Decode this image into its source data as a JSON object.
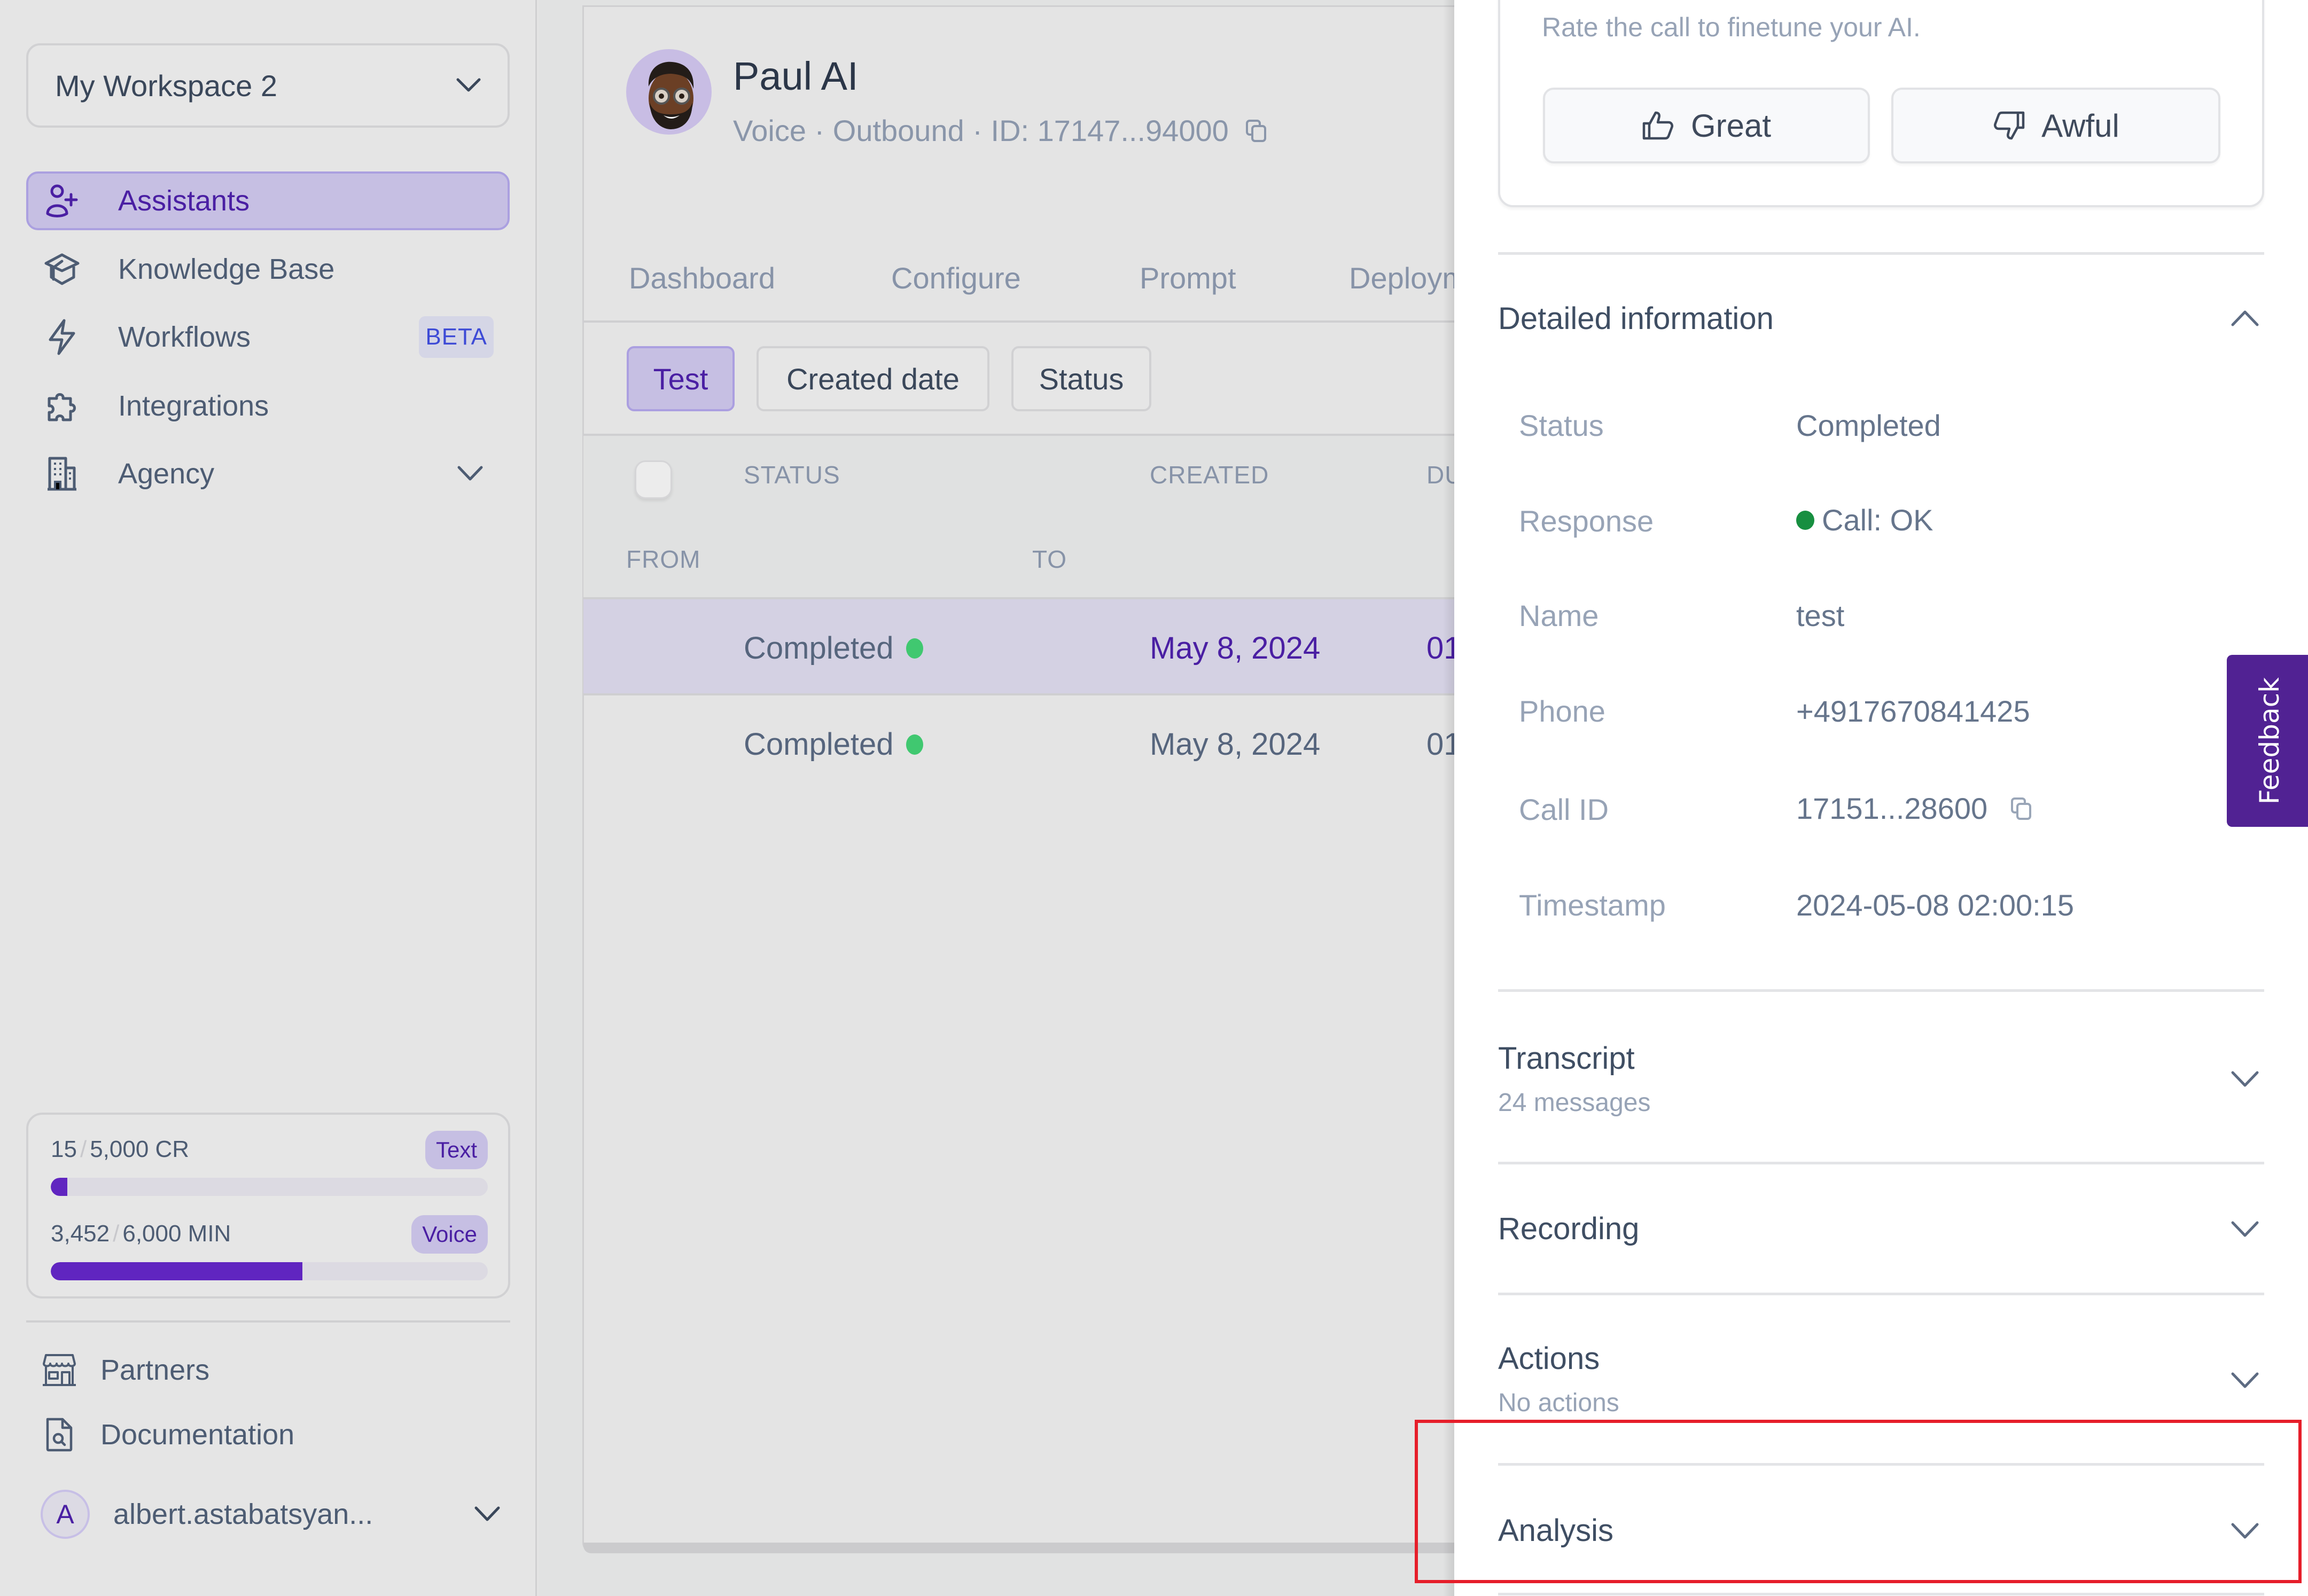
{
  "sidebar": {
    "workspace": "My Workspace 2",
    "nav": [
      {
        "label": "Assistants",
        "icon": "user-plus-icon",
        "active": true
      },
      {
        "label": "Knowledge Base",
        "icon": "graduation-cap-icon"
      },
      {
        "label": "Workflows",
        "icon": "lightning-icon",
        "badge": "BETA"
      },
      {
        "label": "Integrations",
        "icon": "puzzle-icon"
      },
      {
        "label": "Agency",
        "icon": "building-icon",
        "expandable": true
      }
    ],
    "usage": {
      "text": {
        "used": "15",
        "sep": "/",
        "total": "5,000 CR",
        "pill": "Text",
        "used_value": 15,
        "total_value": 5000
      },
      "voice": {
        "used": "3,452",
        "sep": "/",
        "total": "6,000 MIN",
        "pill": "Voice",
        "used_value": 3452,
        "total_value": 6000
      }
    },
    "links": [
      {
        "label": "Partners",
        "icon": "storefront-icon"
      },
      {
        "label": "Documentation",
        "icon": "document-search-icon"
      }
    ],
    "user": {
      "initial": "A",
      "name": "albert.astabatsyan..."
    }
  },
  "assistant": {
    "name": "Paul AI",
    "subtitle": "Voice · Outbound · ID: 17147...94000",
    "tabs": [
      "Dashboard",
      "Configure",
      "Prompt",
      "Deployment"
    ],
    "filters": [
      {
        "label": "Test",
        "active": true
      },
      {
        "label": "Created date"
      },
      {
        "label": "Status"
      }
    ],
    "table": {
      "headers": {
        "status": "STATUS",
        "created": "CREATED",
        "duration": "DURATION",
        "from": "FROM",
        "to": "TO"
      },
      "rows": [
        {
          "status": "Completed",
          "created": "May 8, 2024",
          "duration": "01",
          "selected": true
        },
        {
          "status": "Completed",
          "created": "May 8, 2024",
          "duration": "01",
          "selected": false
        }
      ]
    }
  },
  "panel": {
    "rate": {
      "text": "Rate the call to finetune your AI.",
      "great": "Great",
      "awful": "Awful"
    },
    "detailed": {
      "title": "Detailed information",
      "rows": [
        {
          "label": "Status",
          "value": "Completed"
        },
        {
          "label": "Response",
          "value": "Call: OK"
        },
        {
          "label": "Name",
          "value": "test"
        },
        {
          "label": "Phone",
          "value": "+4917670841425"
        },
        {
          "label": "Call ID",
          "value": "17151...28600"
        },
        {
          "label": "Timestamp",
          "value": "2024-05-08 02:00:15"
        }
      ]
    },
    "sections": [
      {
        "title": "Transcript",
        "sub": "24 messages"
      },
      {
        "title": "Recording",
        "sub": ""
      },
      {
        "title": "Actions",
        "sub": "No actions"
      },
      {
        "title": "Analysis",
        "sub": ""
      }
    ]
  },
  "feedback_tab": "Feedback",
  "colors": {
    "accent": "#6025c0",
    "accent_bg": "#c6bfe3",
    "feedback": "#512293",
    "status_green": "#40c870",
    "response_green": "#178f40",
    "highlight": "#e61e2a"
  }
}
